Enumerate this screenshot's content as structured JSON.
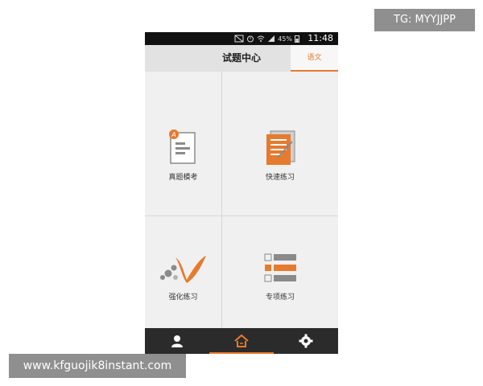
{
  "watermarks": {
    "top": "TG: MYYJJPP",
    "bottom": "www.kfguojik8instant.com"
  },
  "statusbar": {
    "battery": "45%",
    "time": "11:48",
    "icons": [
      "mute-icon",
      "alarm-icon",
      "wifi-icon",
      "signal-icon",
      "battery-icon"
    ]
  },
  "header": {
    "title": "试题中心",
    "subject_tab": "语文"
  },
  "tiles": [
    {
      "label": "真题模考",
      "icon": "exam-paper-icon"
    },
    {
      "label": "快速练习",
      "icon": "quick-practice-icon"
    },
    {
      "label": "强化练习",
      "icon": "intensive-practice-icon"
    },
    {
      "label": "专项练习",
      "icon": "special-practice-icon"
    }
  ],
  "tabbar": {
    "items": [
      "user-icon",
      "home-icon",
      "settings-icon"
    ],
    "active": "home-icon"
  },
  "colors": {
    "accent": "#e67a2e",
    "icon_gray": "#8a8a8a",
    "header_bg": "#e2e2e2",
    "tabbar_bg": "#2b2b2b"
  }
}
